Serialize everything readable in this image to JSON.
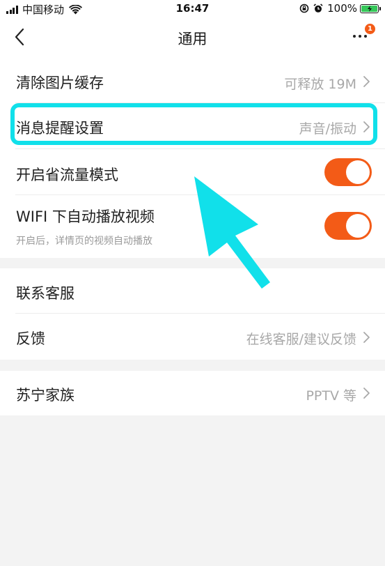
{
  "status_bar": {
    "carrier": "中国移动",
    "time": "16:47",
    "battery_percent": "100%"
  },
  "nav": {
    "title": "通用",
    "badge_count": "1"
  },
  "rows": [
    {
      "title": "清除图片缓存",
      "value": "可释放 19M"
    },
    {
      "title": "消息提醒设置",
      "value": "声音/振动"
    },
    {
      "title": "开启省流量模式"
    },
    {
      "title": "WIFI 下自动播放视频",
      "subtitle": "开启后，详情页的视频自动播放"
    },
    {
      "title": "联系客服"
    },
    {
      "title": "反馈",
      "value": "在线客服/建议反馈"
    },
    {
      "title": "苏宁家族",
      "value": "PPTV 等"
    }
  ],
  "toggles": {
    "save_data_mode": true,
    "wifi_autoplay": true
  },
  "colors": {
    "accent": "#f35b17",
    "highlight": "#11e0ea",
    "background": "#f3f3f3"
  },
  "icons": [
    "signal-icon",
    "wifi-icon",
    "lock-rotation-icon",
    "alarm-icon",
    "battery-icon",
    "back-chevron-icon",
    "more-icon",
    "chevron-right-icon"
  ]
}
